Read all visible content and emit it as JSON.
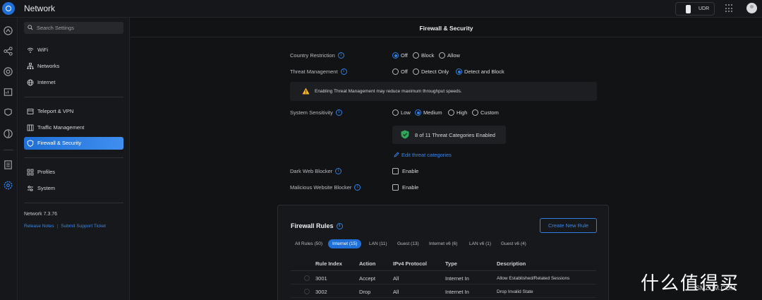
{
  "app": {
    "title": "Network",
    "device": "UDR"
  },
  "search": {
    "placeholder": "Search Settings"
  },
  "nav": {
    "items": [
      {
        "label": "WiFi",
        "icon": "wifi-icon"
      },
      {
        "label": "Networks",
        "icon": "networks-icon"
      },
      {
        "label": "Internet",
        "icon": "globe-icon"
      },
      {
        "label": "Teleport & VPN",
        "icon": "teleport-icon"
      },
      {
        "label": "Traffic Management",
        "icon": "traffic-icon"
      },
      {
        "label": "Firewall & Security",
        "icon": "shield-icon",
        "active": true
      },
      {
        "label": "Profiles",
        "icon": "profiles-icon"
      },
      {
        "label": "System",
        "icon": "system-icon"
      }
    ],
    "version": "Network 7.3.76",
    "links": [
      "Release Notes",
      "Submit Support Ticket"
    ]
  },
  "main": {
    "title": "Firewall & Security",
    "country_restriction": {
      "label": "Country Restriction",
      "options": [
        "Off",
        "Block",
        "Allow"
      ],
      "selected": "Off"
    },
    "threat_management": {
      "label": "Threat Management",
      "options": [
        "Off",
        "Detect Only",
        "Detect and Block"
      ],
      "selected": "Detect and Block"
    },
    "warning": "Enabling Threat Management may reduce maximum throughput speeds.",
    "system_sensitivity": {
      "label": "System Sensitivity",
      "options": [
        "Low",
        "Medium",
        "High",
        "Custom"
      ],
      "selected": "Medium"
    },
    "threat_categories": "8 of 11 Threat Categories Enabled",
    "edit_link": "Edit threat categories",
    "dark_web_blocker": {
      "label": "Dark Web Blocker",
      "option": "Enable",
      "checked": false
    },
    "malicious_website_blocker": {
      "label": "Malicious Website Blocker",
      "option": "Enable",
      "checked": false
    }
  },
  "firewall": {
    "title": "Firewall Rules",
    "create_button": "Create New Rule",
    "tabs": [
      "All Rules (50)",
      "Internet (15)",
      "LAN (11)",
      "Guest (13)",
      "Internet v6 (6)",
      "LAN v6 (1)",
      "Guest v6 (4)"
    ],
    "active_tab": "Internet (15)",
    "columns": [
      "Rule Index",
      "Action",
      "IPv4 Protocol",
      "Type",
      "Description"
    ],
    "rows": [
      [
        "3001",
        "Accept",
        "All",
        "Internet In",
        "Allow Established/Related Sessions"
      ],
      [
        "3002",
        "Drop",
        "All",
        "Internet In",
        "Drop Invalid State"
      ]
    ]
  },
  "watermark": {
    "main": "什么值得买",
    "sub": "SMZDM.COM"
  }
}
